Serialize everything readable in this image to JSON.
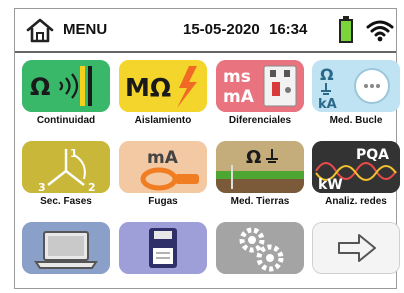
{
  "header": {
    "menu_label": "MENU",
    "date": "15-05-2020",
    "time": "16:34",
    "battery_color": "#7bd43a",
    "icons": [
      "home-icon",
      "battery-icon",
      "wifi-icon"
    ]
  },
  "tiles": {
    "continuidad": {
      "label": "Continuidad",
      "symbol": "Ω",
      "color": "#39b86a"
    },
    "aislamiento": {
      "label": "Aislamiento",
      "symbol": "MΩ",
      "color": "#f3d52b"
    },
    "diferenciales": {
      "label": "Diferenciales",
      "symbol_top": "ms",
      "symbol_bottom": "mA",
      "color": "#e9737f"
    },
    "med_bucle": {
      "label": "Med. Bucle",
      "symbol_top": "Ω",
      "symbol_bottom": "kA",
      "color": "#bfe3f3"
    },
    "sec_fases": {
      "label": "Sec. Fases",
      "n1": "1",
      "n2": "2",
      "n3": "3",
      "color": "#c9b73a"
    },
    "fugas": {
      "label": "Fugas",
      "symbol": "mA",
      "color": "#f3c9a4"
    },
    "med_tierras": {
      "label": "Med. Tierras",
      "symbol": "Ω",
      "color": "#c4ad7b"
    },
    "analiz_redes": {
      "label": "Analiz. redes",
      "symbol_top": "PQA",
      "symbol_bottom": "kW",
      "color": "#333333"
    },
    "memoria": {
      "color": "#8aa0c8",
      "icon": "laptop-icon"
    },
    "guardar": {
      "color": "#9e9fd8",
      "icon": "floppy-disk-icon"
    },
    "ajustes": {
      "color": "#a4a4a4",
      "icon": "gears-icon"
    },
    "siguiente": {
      "color": "#f4f4f4",
      "icon": "arrow-right-icon"
    }
  }
}
